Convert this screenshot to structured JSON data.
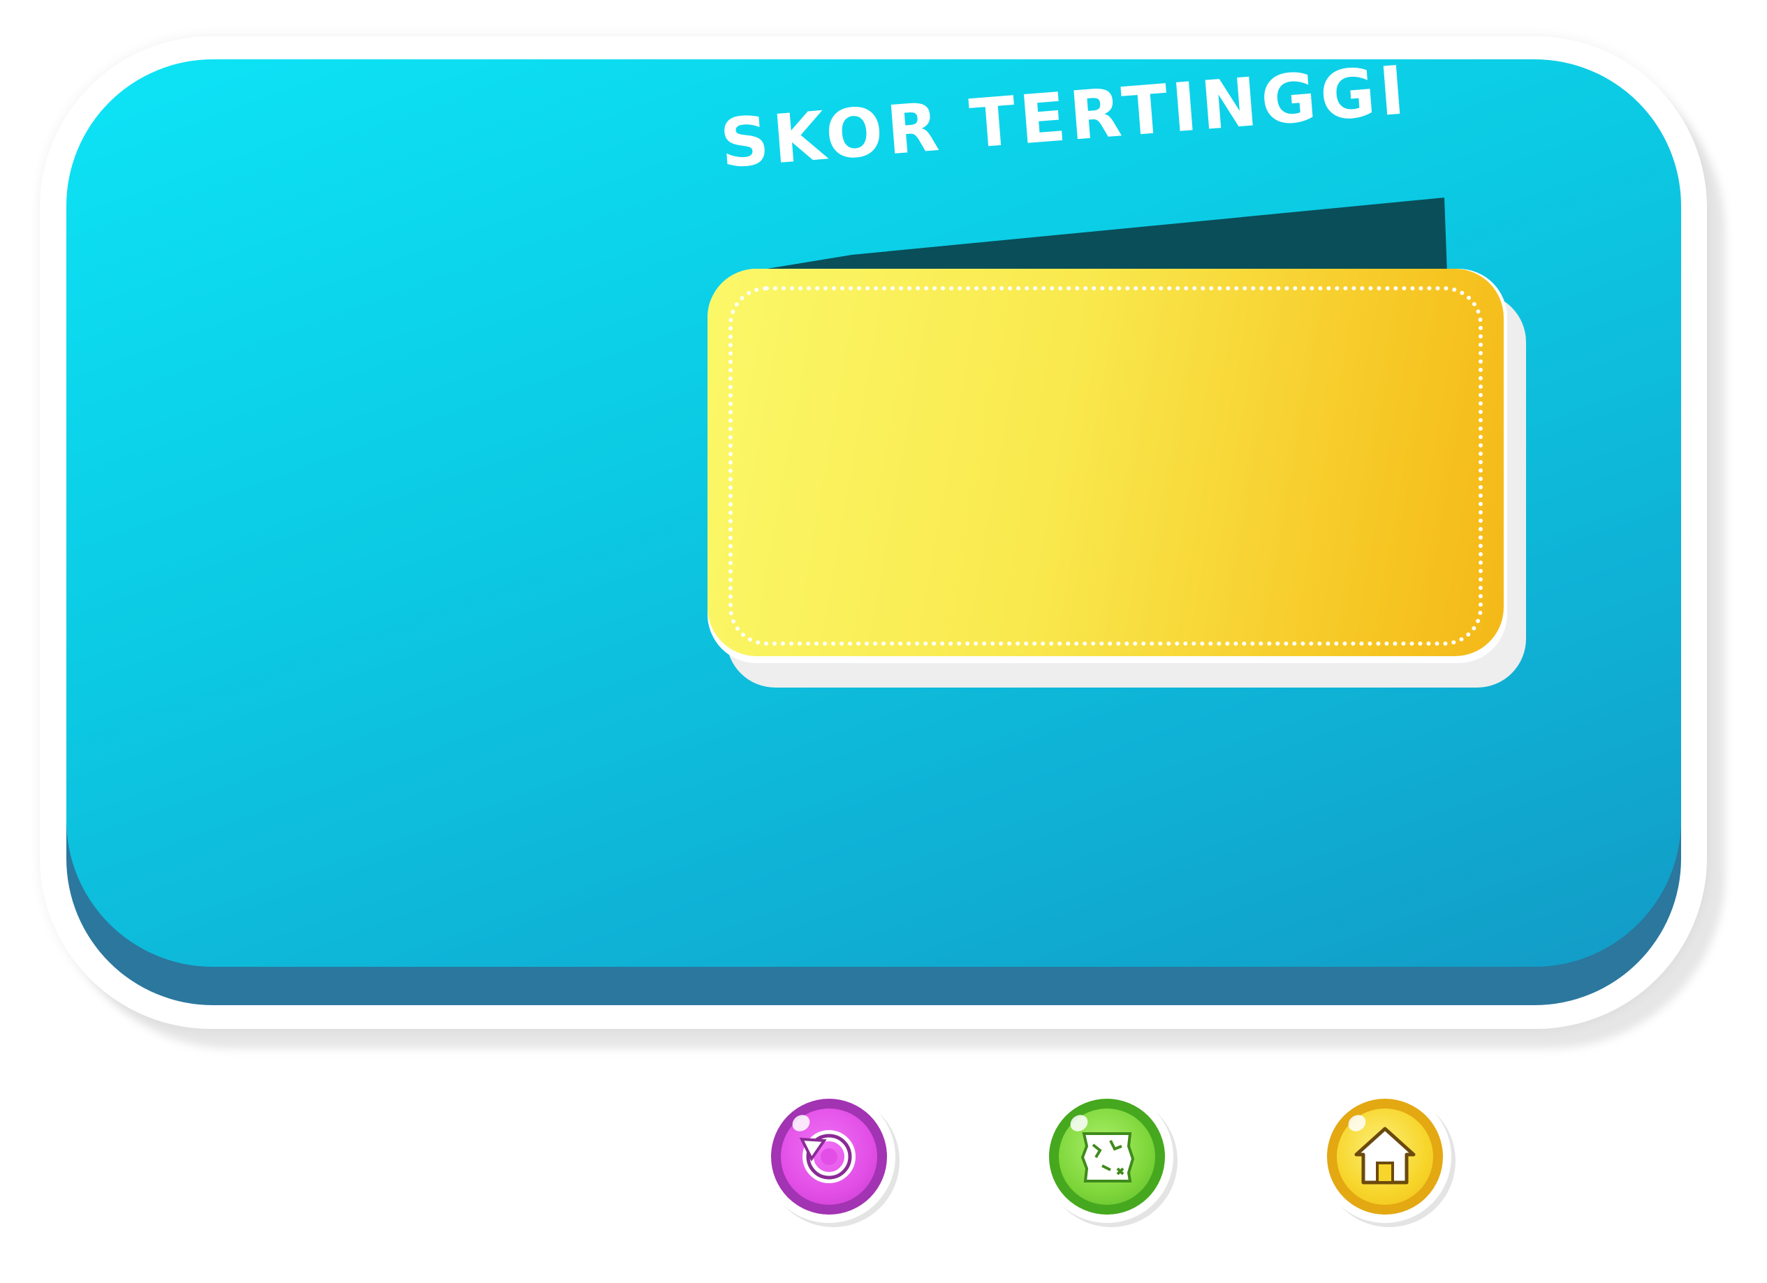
{
  "dialog": {
    "title": "SKOR TERTINGGI",
    "score_value": ""
  },
  "buttons": [
    {
      "icon": "replay-icon",
      "color": "#e24ee6"
    },
    {
      "icon": "map-icon",
      "color": "#7ed63a"
    },
    {
      "icon": "home-icon",
      "color": "#f7d52a"
    }
  ],
  "colors": {
    "panel": "#0ccbe4",
    "panel_edge": "#2b779e",
    "card": "#f9e84d",
    "tab": "#094e59"
  }
}
